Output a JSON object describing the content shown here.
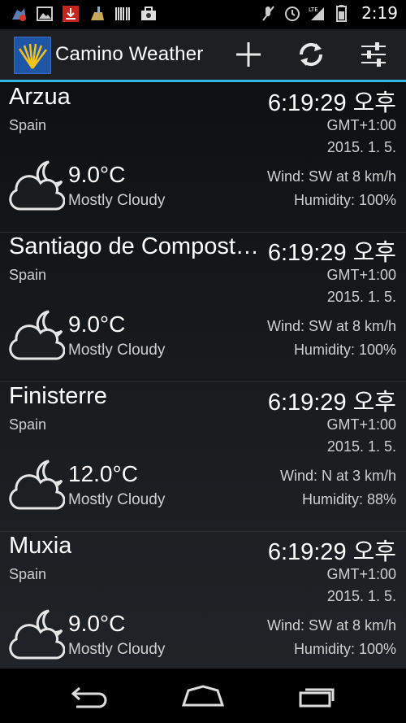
{
  "status_bar": {
    "time": "2:19",
    "left_icons": [
      "app-notification-icon",
      "image-icon",
      "download-icon",
      "cleaner-icon",
      "barcode-icon",
      "briefcase-icon"
    ],
    "right_icons": [
      "mute-icon",
      "alarm-icon",
      "lte-signal-icon",
      "battery-icon"
    ]
  },
  "app_bar": {
    "title": "Camino Weather",
    "actions": [
      "add-icon",
      "refresh-icon",
      "settings-sliders-icon"
    ],
    "accent_color": "#33b5e5"
  },
  "locations": [
    {
      "city": "Arzua",
      "country": "Spain",
      "local_time": "6:19:29 오후",
      "gmt_offset": "GMT+1:00",
      "date": "2015. 1. 5.",
      "temperature": "9.0°C",
      "condition": "Mostly Cloudy",
      "wind": "Wind: SW at 8 km/h",
      "humidity": "Humidity: 100%",
      "icon": "cloud-moon-icon"
    },
    {
      "city": "Santiago de Compost…",
      "country": "Spain",
      "local_time": "6:19:29 오후",
      "gmt_offset": "GMT+1:00",
      "date": "2015. 1. 5.",
      "temperature": "9.0°C",
      "condition": "Mostly Cloudy",
      "wind": "Wind: SW at 8 km/h",
      "humidity": "Humidity: 100%",
      "icon": "cloud-moon-icon"
    },
    {
      "city": "Finisterre",
      "country": "Spain",
      "local_time": "6:19:29 오후",
      "gmt_offset": "GMT+1:00",
      "date": "2015. 1. 5.",
      "temperature": "12.0°C",
      "condition": "Mostly Cloudy",
      "wind": "Wind: N at 3 km/h",
      "humidity": "Humidity: 88%",
      "icon": "cloud-moon-icon"
    },
    {
      "city": "Muxia",
      "country": "Spain",
      "local_time": "6:19:29 오후",
      "gmt_offset": "GMT+1:00",
      "date": "2015. 1. 5.",
      "temperature": "9.0°C",
      "condition": "Mostly Cloudy",
      "wind": "Wind: SW at 8 km/h",
      "humidity": "Humidity: 100%",
      "icon": "cloud-moon-icon"
    }
  ],
  "nav_bar": {
    "buttons": [
      "back-icon",
      "home-icon",
      "recents-icon"
    ]
  }
}
